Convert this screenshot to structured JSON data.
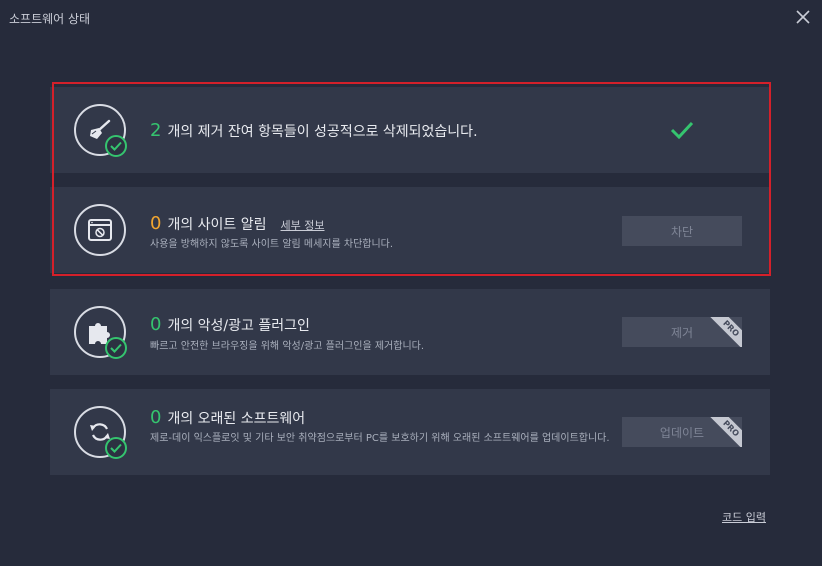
{
  "window": {
    "title": "소프트웨어 상태"
  },
  "icons": {
    "close": "close-icon",
    "success": "checkmark-icon"
  },
  "colors": {
    "green": "#35c46f",
    "orange": "#f0a530",
    "highlight_border": "#d4202a"
  },
  "cards": {
    "leftovers": {
      "count": "2",
      "text": "개의 제거 잔여 항목들이 성공적으로 삭제되었습니다.",
      "icon": "broom-icon"
    },
    "site_alerts": {
      "count": "0",
      "text": "개의 사이트 알림",
      "link": "세부 정보",
      "desc": "사용을 방해하지 않도록 사이트 알림 메세지를 차단합니다.",
      "button": "차단",
      "icon": "browser-block-icon"
    },
    "plugins": {
      "count": "0",
      "text": "개의 악성/광고 플러그인",
      "desc": "빠르고 안전한 브라우징을 위해 악성/광고 플러그인을 제거합니다.",
      "button": "제거",
      "badge": "PRO",
      "icon": "puzzle-icon"
    },
    "outdated": {
      "count": "0",
      "text": "개의 오래된 소프트웨어",
      "desc": "제로-데이 익스플로잇 및 기타 보안 취약점으로부터 PC를 보호하기 위해 오래된 소프트웨어를 업데이트합니다.",
      "button": "업데이트",
      "badge": "PRO",
      "icon": "refresh-icon"
    }
  },
  "footer": {
    "code_link": "코드 입력"
  }
}
